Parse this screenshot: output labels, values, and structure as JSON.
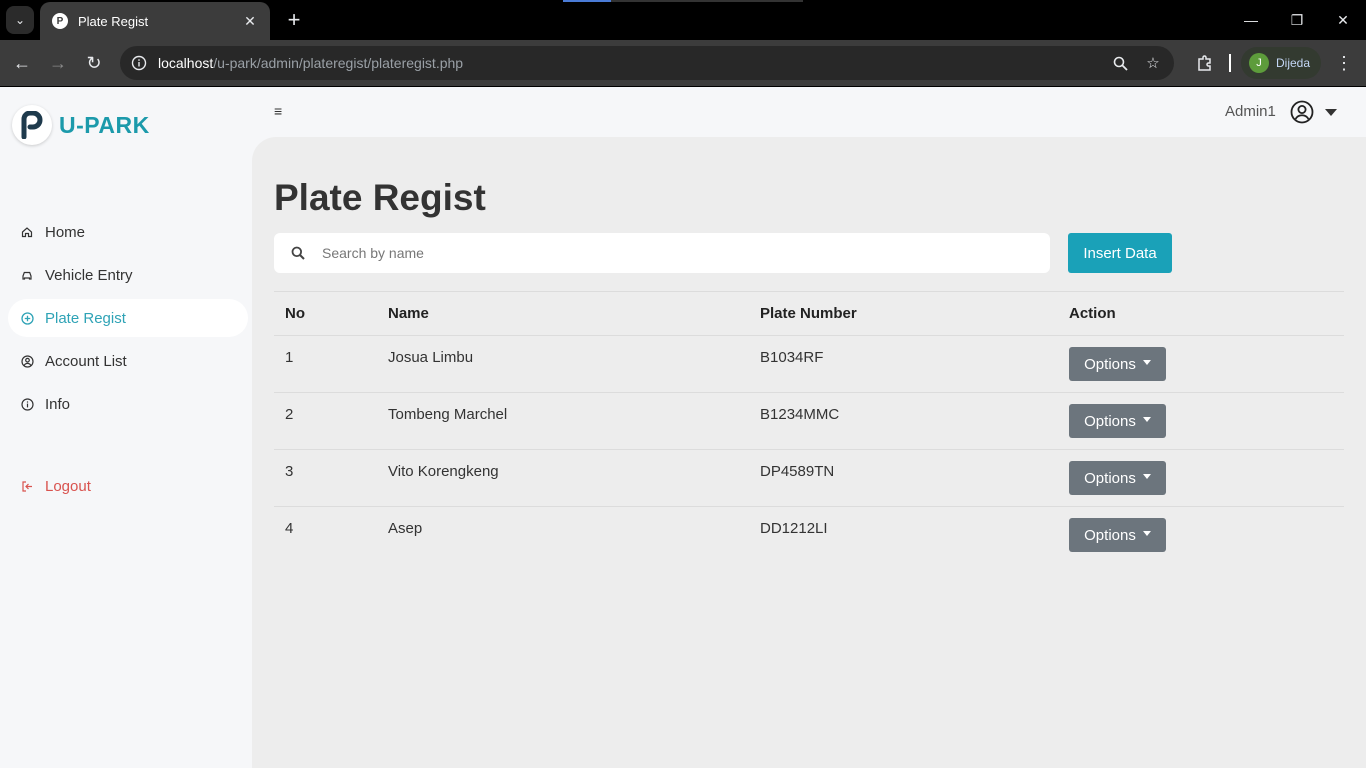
{
  "browser": {
    "tab_title": "Plate Regist",
    "url_host": "localhost",
    "url_path": "/u-park/admin/plateregist/plateregist.php",
    "profile_initial": "J",
    "profile_name": "Dijeda"
  },
  "app": {
    "logo_text": "U-PARK",
    "admin_name": "Admin1"
  },
  "sidebar": {
    "items": [
      {
        "label": "Home",
        "icon": "home-icon",
        "active": false
      },
      {
        "label": "Vehicle Entry",
        "icon": "car-icon",
        "active": false
      },
      {
        "label": "Plate Regist",
        "icon": "plus-circle-icon",
        "active": true
      },
      {
        "label": "Account List",
        "icon": "user-circle-icon",
        "active": false
      },
      {
        "label": "Info",
        "icon": "info-icon",
        "active": false
      }
    ],
    "logout_label": "Logout"
  },
  "main": {
    "title": "Plate Regist",
    "search_placeholder": "Search by name",
    "insert_label": "Insert Data",
    "columns": [
      "No",
      "Name",
      "Plate Number",
      "Action"
    ],
    "rows": [
      {
        "no": "1",
        "name": "Josua Limbu",
        "plate": "B1034RF",
        "action": "Options"
      },
      {
        "no": "2",
        "name": "Tombeng Marchel",
        "plate": "B1234MMC",
        "action": "Options"
      },
      {
        "no": "3",
        "name": "Vito Korengkeng",
        "plate": "DP4589TN",
        "action": "Options"
      },
      {
        "no": "4",
        "name": "Asep",
        "plate": "DD1212LI",
        "action": "Options"
      }
    ]
  },
  "colors": {
    "accent": "#1aa1b8",
    "logout": "#d9534f",
    "options_button": "#6c757d"
  }
}
